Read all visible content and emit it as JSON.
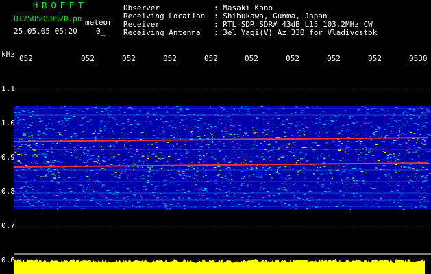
{
  "header": {
    "brand": "HROFFT",
    "filename": "UT2505050520.pn",
    "mode": "meteor",
    "datetime": "25.05.05 05:20",
    "count": "0_",
    "rows": [
      {
        "label": "Observer",
        "value": ": Masaki Kano"
      },
      {
        "label": "Receiving Location",
        "value": ": Shibukawa, Gunma, Japan"
      },
      {
        "label": "Receiver",
        "value": ": RTL-SDR SDR# 43dB L15 103.2MHz CW"
      },
      {
        "label": "Receiving Antenna",
        "value": ": 3el Yagi(V) Az 330 for Vladivostok"
      }
    ]
  },
  "axis": {
    "unit": "kHz",
    "time_ticks": [
      "052",
      "052",
      "052",
      "052",
      "052",
      "052",
      "052",
      "052",
      "052",
      "0530"
    ],
    "freq_ticks": [
      "1.1",
      "1.0",
      "0.9",
      "0.8",
      "0.7",
      "0.6"
    ]
  },
  "colors": {
    "background": "#000000",
    "text": "#ffffff",
    "brand": "#00ff00",
    "noise_low": "#0000aa",
    "noise_high": "#00ffff",
    "carrier": "#ff3030",
    "volume": "#ffff00"
  }
}
